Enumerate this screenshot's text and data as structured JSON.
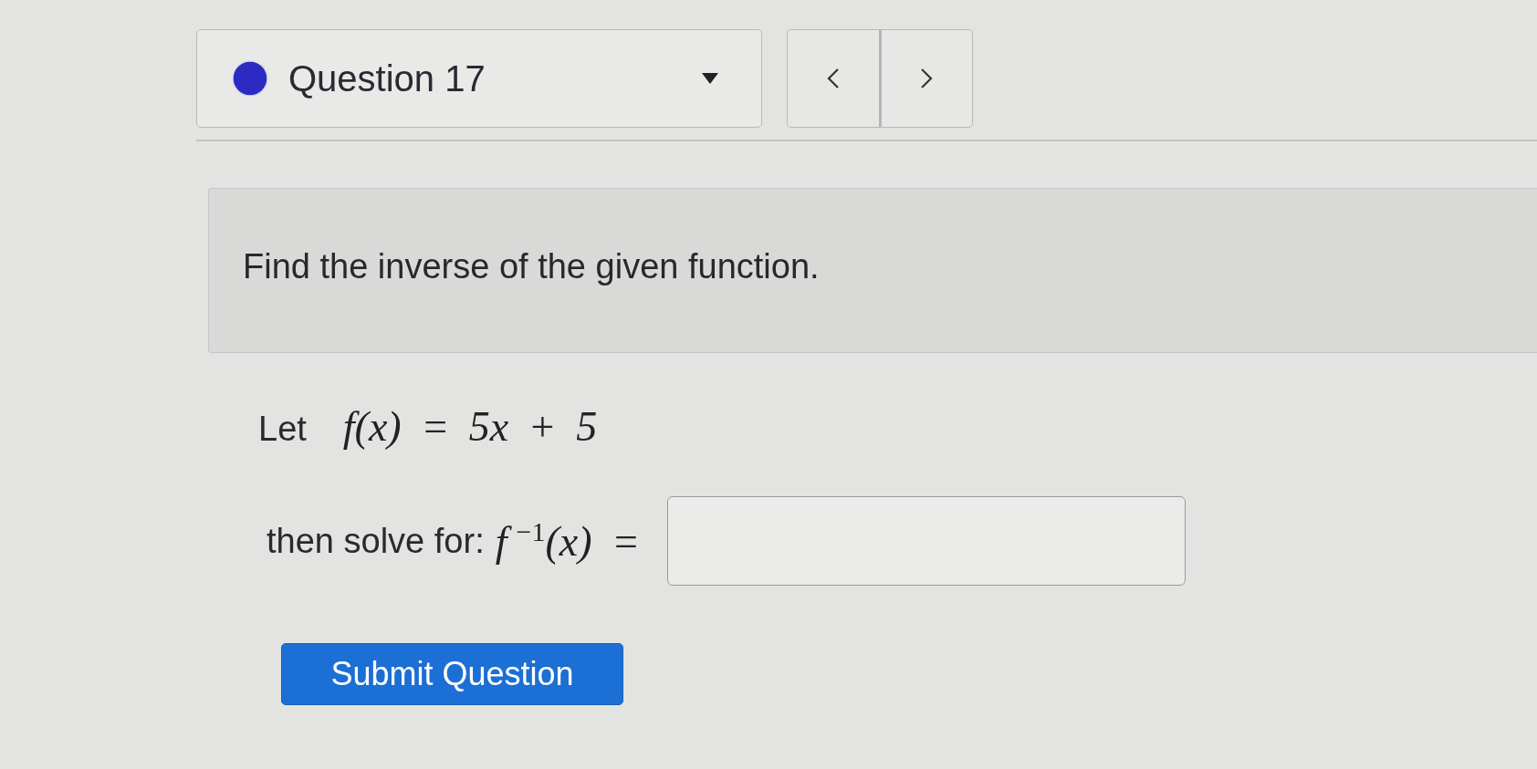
{
  "question_selector": {
    "label": "Question 17"
  },
  "prompt": {
    "text": "Find the inverse of the given function."
  },
  "given": {
    "label": "Let",
    "formula": "f(x) = 5x + 5"
  },
  "answer": {
    "label": "then solve for:",
    "formula": "f$^{−1}$(x) ="
  },
  "submit_button": {
    "label": "Submit Question"
  }
}
